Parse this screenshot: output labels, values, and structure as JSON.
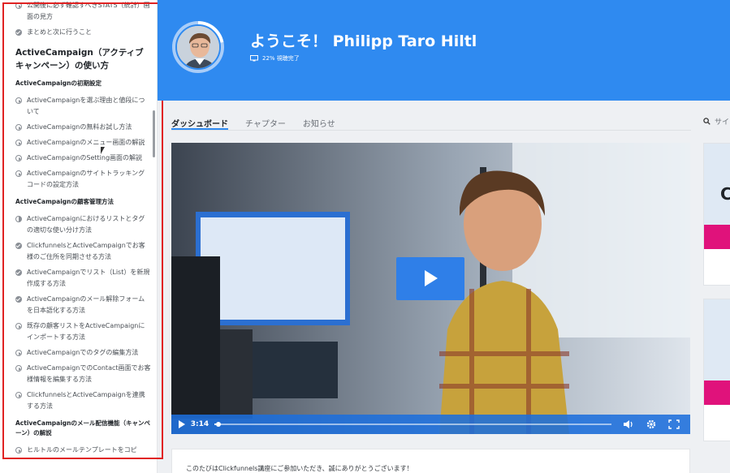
{
  "sidebar": {
    "top_fragment": "",
    "items_top": [
      {
        "icon": "play",
        "label": "公開後に必ず確認すべきSTATS（統計）画面の見方"
      },
      {
        "icon": "check",
        "label": "まとめと次に行うこと"
      }
    ],
    "section_title": "ActiveCampaign（アクティブキャンペーン）の使い方",
    "groups": [
      {
        "title": "ActiveCampaignの初期設定",
        "items": [
          {
            "icon": "play",
            "label": "ActiveCampaignを選ぶ理由と値段について"
          },
          {
            "icon": "play",
            "label": "ActiveCampaignの無料お試し方法"
          },
          {
            "icon": "play",
            "label": "ActiveCampaignのメニュー画面の解説"
          },
          {
            "icon": "play",
            "label": "ActiveCampaignのSetting画面の解説"
          },
          {
            "icon": "play",
            "label": "ActiveCampaignのサイトトラッキングコードの設定方法"
          }
        ]
      },
      {
        "title": "ActiveCampaignの顧客管理方法",
        "items": [
          {
            "icon": "half",
            "label": "ActiveCampaignにおけるリストとタグの適切な使い分け方法"
          },
          {
            "icon": "check",
            "label": "ClickfunnelsとActiveCampaignでお客様のご住所を同期させる方法"
          },
          {
            "icon": "check",
            "label": "ActiveCampaignでリスト（List）を新規作成する方法"
          },
          {
            "icon": "check",
            "label": "ActiveCampaignのメール解除フォームを日本語化する方法"
          },
          {
            "icon": "play",
            "label": "既存の顧客リストをActiveCampaignにインポートする方法"
          },
          {
            "icon": "play",
            "label": "ActiveCampaignでのタグの編集方法"
          },
          {
            "icon": "play",
            "label": "ActiveCampaignでのContact画面でお客様情報を編集する方法"
          },
          {
            "icon": "play",
            "label": "ClickfunnelsとActiveCampaignを連携する方法"
          }
        ]
      },
      {
        "title": "ActiveCampaignのメール配信機能（キャンペーン）の解説",
        "items": [
          {
            "icon": "play",
            "label": "ヒルトルのメールテンプレートをコピ"
          }
        ]
      }
    ]
  },
  "header": {
    "welcome": "ようこそ！ Philipp Taro Hiltl",
    "progress_text": "22% 視聴完了",
    "progress_fraction": 0.22
  },
  "tabs": [
    {
      "label": "ダッシュボード",
      "active": true
    },
    {
      "label": "チャプター",
      "active": false
    },
    {
      "label": "お知らせ",
      "active": false
    }
  ],
  "search": {
    "label": "サイ"
  },
  "video": {
    "time": "3:14",
    "progress_fraction": 0.01
  },
  "right_card": {
    "letter": "C"
  },
  "info": {
    "text": "このたびはClickfunnels講座にご参加いただき、誠にありがとうございます！"
  },
  "colors": {
    "header_blue": "#2f8af0",
    "video_blue": "#2f7fe8",
    "highlight_red": "#e02323",
    "pink": "#e0127b"
  }
}
